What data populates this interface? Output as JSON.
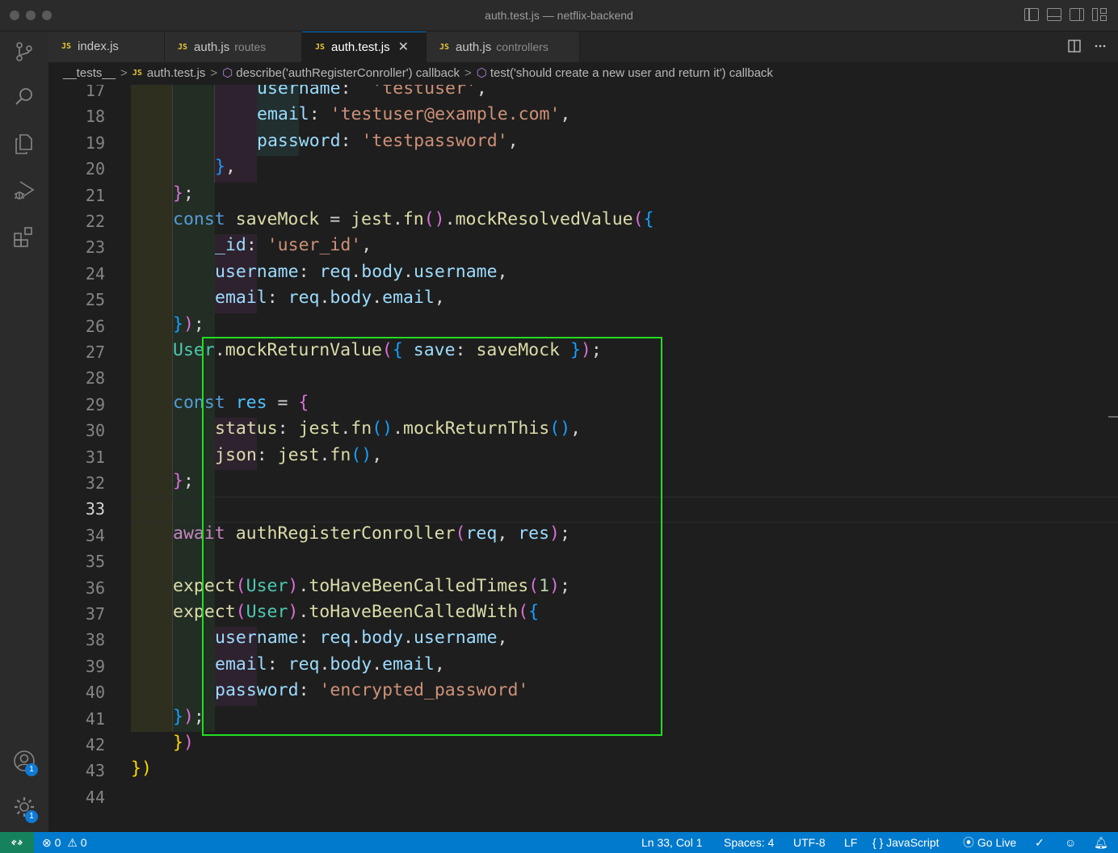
{
  "window": {
    "title": "auth.test.js — netflix-backend"
  },
  "tabs": [
    {
      "name": "index.js",
      "desc": "",
      "icon": "JS"
    },
    {
      "name": "auth.js",
      "desc": "routes",
      "icon": "JS"
    },
    {
      "name": "auth.test.js",
      "desc": "",
      "icon": "JS",
      "close": "✕"
    },
    {
      "name": "auth.js",
      "desc": "controllers",
      "icon": "JS"
    }
  ],
  "breadcrumb": {
    "folder": "__tests__",
    "file_icon": "JS",
    "file": "auth.test.js",
    "scope1": "describe('authRegisterConroller') callback",
    "scope2": "test('should create a new user and return it') callback",
    "separator": ">"
  },
  "activity_bar": {
    "icons": [
      "source-control-icon",
      "search-icon",
      "explorer-icon",
      "run-debug-icon",
      "extensions-icon",
      "accounts-icon",
      "manage-gear-icon"
    ],
    "accounts_badge": "1",
    "manage_badge": "1"
  },
  "editor": {
    "current_line": "33",
    "line_numbers": [
      "17",
      "18",
      "19",
      "20",
      "21",
      "22",
      "23",
      "24",
      "25",
      "26",
      "27",
      "28",
      "29",
      "30",
      "31",
      "32",
      "33",
      "34",
      "35",
      "36",
      "37",
      "38",
      "39",
      "40",
      "41",
      "42",
      "43",
      "44"
    ]
  },
  "statusbar": {
    "errors": "0",
    "warnings": "0",
    "position": "Ln 33, Col 1",
    "spaces": "Spaces: 4",
    "encoding": "UTF-8",
    "eol": "LF",
    "language_icon": "{ }",
    "language": "JavaScript",
    "golive": "Go Live"
  },
  "colors": {
    "status_bar": "#007acc",
    "remote": "#16825d",
    "highlight_box": "#22dd22"
  }
}
